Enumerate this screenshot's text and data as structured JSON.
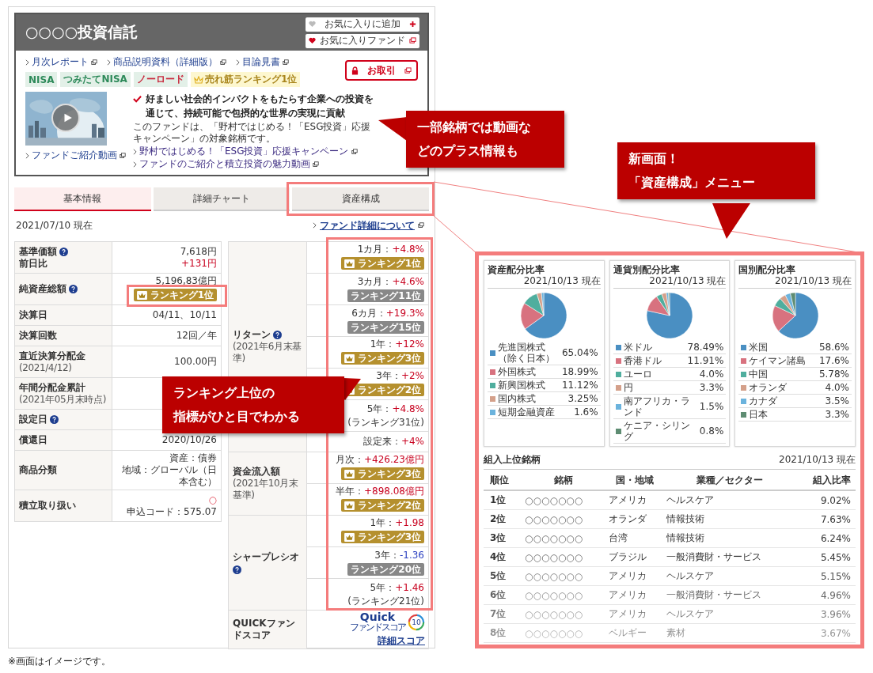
{
  "header": {
    "title": "○○○○投資信託",
    "actions": [
      {
        "label": "お気に入りに追加",
        "kind": "add"
      },
      {
        "label": "お気に入りファンド",
        "kind": "list"
      }
    ],
    "links": [
      "月次レポート",
      "商品説明資料（詳細版）",
      "目論見書"
    ],
    "tags": [
      {
        "label": "NISA",
        "kind": "plain",
        "color": "#2e8a5a"
      },
      {
        "label": "つみたてNISA",
        "kind": "plain",
        "color": "#2e8a5a"
      },
      {
        "label": "ノーロード",
        "kind": "plain",
        "color": "#c8283c"
      },
      {
        "label": "売れ筋ランキング1位",
        "kind": "ranking",
        "color": "#a8841a"
      }
    ],
    "trade_button": "お取引",
    "video": {
      "kind": "picture",
      "link": "ファンドご紹介動画"
    },
    "headline": "好ましい社会的インパクトをもたらす企業への投資を通じて、持続可能で包摂的な世界の実現に貢献",
    "description": "このファンドは、「野村ではじめる！「ESG投資」応援キャンペーン」の対象銘柄です。",
    "related_links": [
      "野村ではじめる！「ESG投資」応援キャンペーン",
      "ファンドのご紹介と積立投資の魅力動画"
    ]
  },
  "tabs": [
    {
      "label": "基本情報",
      "selected": true
    },
    {
      "label": "詳細チャート",
      "selected": false
    },
    {
      "label": "資産構成",
      "selected": false
    }
  ],
  "as_of": "2021/07/10 現在",
  "detail_link": "ファンド詳細について",
  "basic_table": [
    {
      "label": "基準価額",
      "help": true,
      "label2": "前日比",
      "values": [
        {
          "text": "7,618円",
          "kind": "normal"
        },
        {
          "text": "+131円",
          "kind": "up"
        }
      ]
    },
    {
      "label": "純資産総額",
      "help": true,
      "values": [
        {
          "text": "5,196,83億円",
          "kind": "normal"
        }
      ],
      "badge": {
        "text": "ランキング1位",
        "kind": "gold"
      }
    },
    {
      "label": "決算日",
      "help": false,
      "values": [
        {
          "text": "04/11、10/11",
          "kind": "normal"
        }
      ]
    },
    {
      "label": "決算回数",
      "help": false,
      "values": [
        {
          "text": "12回／年",
          "kind": "normal"
        }
      ]
    },
    {
      "label": "直近決算分配金",
      "help": false,
      "note": "(2021/4/12)",
      "values": [
        {
          "text": "100.00円",
          "kind": "normal"
        }
      ]
    },
    {
      "label": "年間分配金累計",
      "help": false,
      "note": "(2021年05月末時点)"
    },
    {
      "label": "設定日",
      "help": true
    },
    {
      "label": "償還日",
      "help": false,
      "values": [
        {
          "text": "2020/10/26",
          "kind": "normal"
        }
      ]
    },
    {
      "label": "商品分類",
      "help": false,
      "values": [
        {
          "text": "資産：債券",
          "kind": "normal"
        },
        {
          "text": "地域：グローバル（日本含む）",
          "kind": "normal"
        }
      ]
    },
    {
      "label": "積立取り扱い",
      "help": false,
      "values": [
        {
          "text": "○",
          "kind": "symbol"
        },
        {
          "text": "申込コード：575.07",
          "kind": "normal"
        }
      ]
    }
  ],
  "metrics": [
    {
      "label": "リターン",
      "help": true,
      "note": "(2021年6月末基準)",
      "items": [
        {
          "period": "1カ月：",
          "value": "+4.8%",
          "color": "#c8001e",
          "badge": {
            "text": "ランキング1位",
            "kind": "gold"
          }
        },
        {
          "period": "3カ月：",
          "value": "+4.6%",
          "color": "#c8001e",
          "badge": {
            "text": "ランキング11位",
            "kind": "gray"
          }
        },
        {
          "period": "6カ月：",
          "value": "+19.3%",
          "color": "#c8001e",
          "badge": {
            "text": "ランキング15位",
            "kind": "gray"
          }
        },
        {
          "period": "1年：",
          "value": "+12%",
          "color": "#c8001e",
          "badge": {
            "text": "ランキング3位",
            "kind": "gold"
          }
        },
        {
          "period": "3年：",
          "value": "+2%",
          "color": "#c8001e",
          "badge": {
            "text": "ランキング2位",
            "kind": "gold"
          }
        },
        {
          "period": "5年：",
          "value": "+4.8%",
          "color": "#c8001e",
          "badge": {
            "text": "(ランキング31位)",
            "kind": "plain"
          }
        },
        {
          "period": "設定来：",
          "value": "+4%",
          "color": "#c8001e"
        }
      ]
    },
    {
      "label": "資金流入額",
      "help": false,
      "note": "(2021年10月末基準)",
      "items": [
        {
          "period": "月次：",
          "value": "+426.23億円",
          "color": "#c8001e",
          "badge": {
            "text": "ランキング3位",
            "kind": "gold"
          }
        },
        {
          "period": "半年：",
          "value": "+898.08億円",
          "color": "#c8001e",
          "badge": {
            "text": "ランキング2位",
            "kind": "gold"
          }
        }
      ]
    },
    {
      "label": "シャープレシオ",
      "help": true,
      "items": [
        {
          "period": "1年：",
          "value": "+1.98",
          "color": "#c8001e",
          "badge": {
            "text": "ランキング3位",
            "kind": "gold"
          }
        },
        {
          "period": "3年：",
          "value": "-1.36",
          "color": "#2a3fc0",
          "badge": {
            "text": "ランキング20位",
            "kind": "gray"
          }
        },
        {
          "period": "5年：",
          "value": "+1.46",
          "color": "#c8001e",
          "badge": {
            "text": "(ランキング21位)",
            "kind": "plain"
          }
        }
      ]
    }
  ],
  "quick_score": {
    "label": "QUICKファンドスコア",
    "logo": "Quick",
    "logo_sub": "ファンドスコア",
    "score": "10",
    "link": "詳細スコア"
  },
  "footnote": "※画面はイメージです。",
  "allocations": [
    {
      "title": "資産配分比率",
      "as_of": "2021/10/13 現在",
      "chart_data": {
        "type": "pie",
        "categories": [
          "先進国株式（除く日本）",
          "外国株式",
          "新興国株式",
          "国内株式",
          "短期金融資産"
        ],
        "series": [
          {
            "values": [
              65.04,
              18.99,
              11.12,
              3.25,
              1.6
            ]
          }
        ],
        "value_labels": [
          "65.04%",
          "18.99%",
          "11.12%",
          "3.25%",
          "1.6%"
        ],
        "colors": [
          "#4a8fc2",
          "#d8727f",
          "#4fae9e",
          "#d4a08a",
          "#6bb3dd"
        ]
      }
    },
    {
      "title": "通貨別配分比率",
      "as_of": "2021/10/13 現在",
      "chart_data": {
        "type": "pie",
        "categories": [
          "米ドル",
          "香港ドル",
          "ユーロ",
          "円",
          "南アフリカ・ランド",
          "ケニア・シリング"
        ],
        "series": [
          {
            "values": [
              78.49,
              11.91,
              4.0,
              3.3,
              1.5,
              0.8
            ]
          }
        ],
        "value_labels": [
          "78.49%",
          "11.91%",
          "4.0%",
          "3.3%",
          "1.5%",
          "0.8%"
        ],
        "colors": [
          "#4a8fc2",
          "#d8727f",
          "#4fae9e",
          "#d4a08a",
          "#6bb3dd",
          "#5e8c72"
        ]
      }
    },
    {
      "title": "国別配分比率",
      "as_of": "2021/10/13 現在",
      "chart_data": {
        "type": "pie",
        "categories": [
          "米国",
          "ケイマン諸島",
          "中国",
          "オランダ",
          "カナダ",
          "日本"
        ],
        "series": [
          {
            "values": [
              63.16,
              18.97,
              6.23,
              4.31,
              3.77,
              3.56
            ]
          }
        ],
        "value_labels": [
          "58.6%",
          "17.6%",
          "5.78%",
          "4.0%",
          "3.5%",
          "3.3%"
        ],
        "colors": [
          "#4a8fc2",
          "#d8727f",
          "#4fae9e",
          "#d4a08a",
          "#6bb3dd",
          "#5e8c72"
        ]
      }
    }
  ],
  "holdings": {
    "title": "組入上位銘柄",
    "as_of": "2021/10/13 現在",
    "columns": [
      "順位",
      "銘柄",
      "国・地域",
      "業種／セクター",
      "組入比率"
    ],
    "rows": [
      [
        "1位",
        "○○○○○○○",
        "アメリカ",
        "ヘルスケア",
        "9.02%"
      ],
      [
        "2位",
        "○○○○○○○",
        "オランダ",
        "情報技術",
        "7.63%"
      ],
      [
        "3位",
        "○○○○○○○",
        "台湾",
        "情報技術",
        "6.24%"
      ],
      [
        "4位",
        "○○○○○○○",
        "ブラジル",
        "一般消費財・サービス",
        "5.45%"
      ],
      [
        "5位",
        "○○○○○○○",
        "アメリカ",
        "ヘルスケア",
        "5.15%"
      ],
      [
        "6位",
        "○○○○○○○",
        "アメリカ",
        "一般消費財・サービス",
        "4.96%"
      ],
      [
        "7位",
        "○○○○○○○",
        "アメリカ",
        "ヘルスケア",
        "3.96%"
      ],
      [
        "8位",
        "○○○○○○○",
        "ベルギー",
        "素材",
        "3.67%"
      ]
    ]
  },
  "callouts": [
    {
      "lines": [
        "一部銘柄では動画な",
        "どのプラス情報も"
      ]
    },
    {
      "lines": [
        "新画面！",
        "「資産構成」メニュー"
      ]
    },
    {
      "lines": [
        "ランキング上位の",
        "指標がひと目でわかる"
      ]
    }
  ]
}
